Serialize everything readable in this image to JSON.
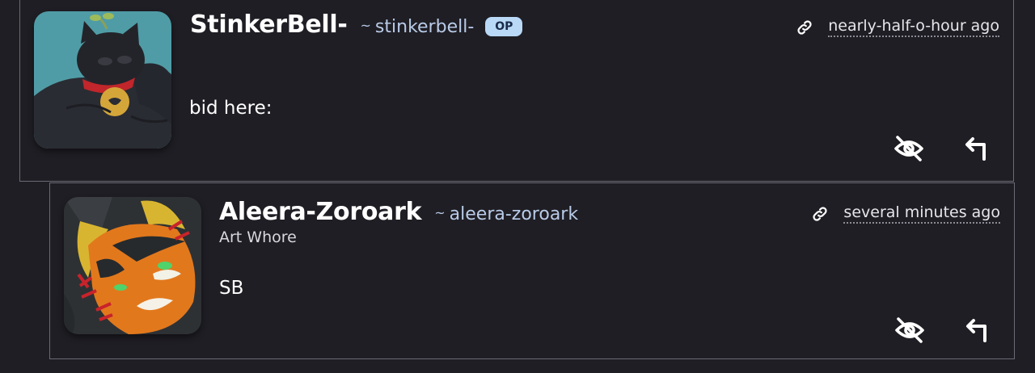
{
  "comments": [
    {
      "display_name": "StinkerBell-",
      "handle_prefix": "~",
      "handle": "stinkerbell-",
      "badge": "OP",
      "user_title": "",
      "timestamp": "nearly-half-o-hour ago",
      "body": "bid here:",
      "avatar": "black-cat-avatar",
      "actions": [
        {
          "icon": "eye-slash-icon"
        },
        {
          "icon": "reply-arrow-icon"
        }
      ]
    },
    {
      "display_name": "Aleera-Zoroark",
      "handle_prefix": "~",
      "handle": "aleera-zoroark",
      "badge": "",
      "user_title": "Art Whore",
      "timestamp": "several minutes ago",
      "body": "SB",
      "avatar": "orange-fox-avatar",
      "actions": [
        {
          "icon": "eye-slash-icon"
        },
        {
          "icon": "reply-arrow-icon"
        }
      ]
    }
  ],
  "colors": {
    "background": "#1f1e24",
    "border": "#6b6a76",
    "handle": "#b9cbe8",
    "op_badge_bg": "#b9d9f7",
    "op_badge_text": "#1b2b4a"
  }
}
